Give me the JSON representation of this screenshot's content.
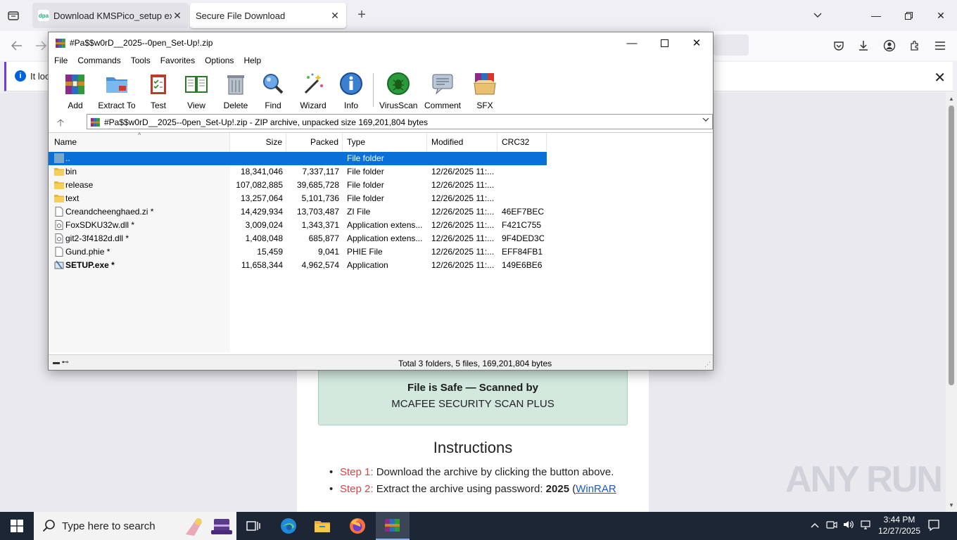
{
  "browser": {
    "tabs": [
      {
        "label": "Download KMSPico_setup exe",
        "favicon_text": "dpa"
      },
      {
        "label": "Secure File Download"
      }
    ],
    "infobar_text": "It loo"
  },
  "page": {
    "safe_title": "File is Safe — Scanned by",
    "safe_sub": "MCAFEE SECURITY SCAN PLUS",
    "instructions_title": "Instructions",
    "steps": [
      {
        "label": "Step 1:",
        "text": " Download the archive by clicking the button above."
      },
      {
        "label": "Step 2:",
        "text": " Extract the archive using password: ",
        "bold": "2025",
        "after": " (",
        "link": "WinRAR"
      }
    ],
    "watermark": "ANY RUN"
  },
  "winrar": {
    "title": "#Pa$$w0rD__2025--0pen_Set-Up!.zip",
    "menu": [
      "File",
      "Commands",
      "Tools",
      "Favorites",
      "Options",
      "Help"
    ],
    "toolbar": [
      "Add",
      "Extract To",
      "Test",
      "View",
      "Delete",
      "Find",
      "Wizard",
      "Info",
      "VirusScan",
      "Comment",
      "SFX"
    ],
    "address": "#Pa$$w0rD__2025--0pen_Set-Up!.zip - ZIP archive, unpacked size 169,201,804 bytes",
    "columns": [
      "Name",
      "Size",
      "Packed",
      "Type",
      "Modified",
      "CRC32"
    ],
    "rows": [
      {
        "name": "..",
        "size": "",
        "packed": "",
        "type": "File folder",
        "modified": "",
        "crc": "",
        "icon": "up-folder"
      },
      {
        "name": "bin",
        "size": "18,341,046",
        "packed": "7,337,117",
        "type": "File folder",
        "modified": "12/26/2025 11:...",
        "crc": "",
        "icon": "folder"
      },
      {
        "name": "release",
        "size": "107,082,885",
        "packed": "39,685,728",
        "type": "File folder",
        "modified": "12/26/2025 11:...",
        "crc": "",
        "icon": "folder"
      },
      {
        "name": "text",
        "size": "13,257,064",
        "packed": "5,101,736",
        "type": "File folder",
        "modified": "12/26/2025 11:...",
        "crc": "",
        "icon": "folder"
      },
      {
        "name": "Creandcheenghaed.zi *",
        "size": "14,429,934",
        "packed": "13,703,487",
        "type": "ZI File",
        "modified": "12/26/2025 11:...",
        "crc": "46EF7BEC",
        "icon": "file"
      },
      {
        "name": "FoxSDKU32w.dll *",
        "size": "3,009,024",
        "packed": "1,343,371",
        "type": "Application extens...",
        "modified": "12/26/2025 11:...",
        "crc": "F421C755",
        "icon": "dll"
      },
      {
        "name": "git2-3f4182d.dll *",
        "size": "1,408,048",
        "packed": "685,877",
        "type": "Application extens...",
        "modified": "12/26/2025 11:...",
        "crc": "9F4DED3C",
        "icon": "dll"
      },
      {
        "name": "Gund.phie *",
        "size": "15,459",
        "packed": "9,041",
        "type": "PHIE File",
        "modified": "12/26/2025 11:...",
        "crc": "EFF84FB1",
        "icon": "file"
      },
      {
        "name": "SETUP.exe *",
        "size": "11,658,344",
        "packed": "4,962,574",
        "type": "Application",
        "modified": "12/26/2025 11:...",
        "crc": "149E6BE6",
        "icon": "exe"
      }
    ],
    "status": "Total 3 folders, 5 files, 169,201,804 bytes"
  },
  "taskbar": {
    "search_placeholder": "Type here to search",
    "time": "3:44 PM",
    "date": "12/27/2025"
  }
}
